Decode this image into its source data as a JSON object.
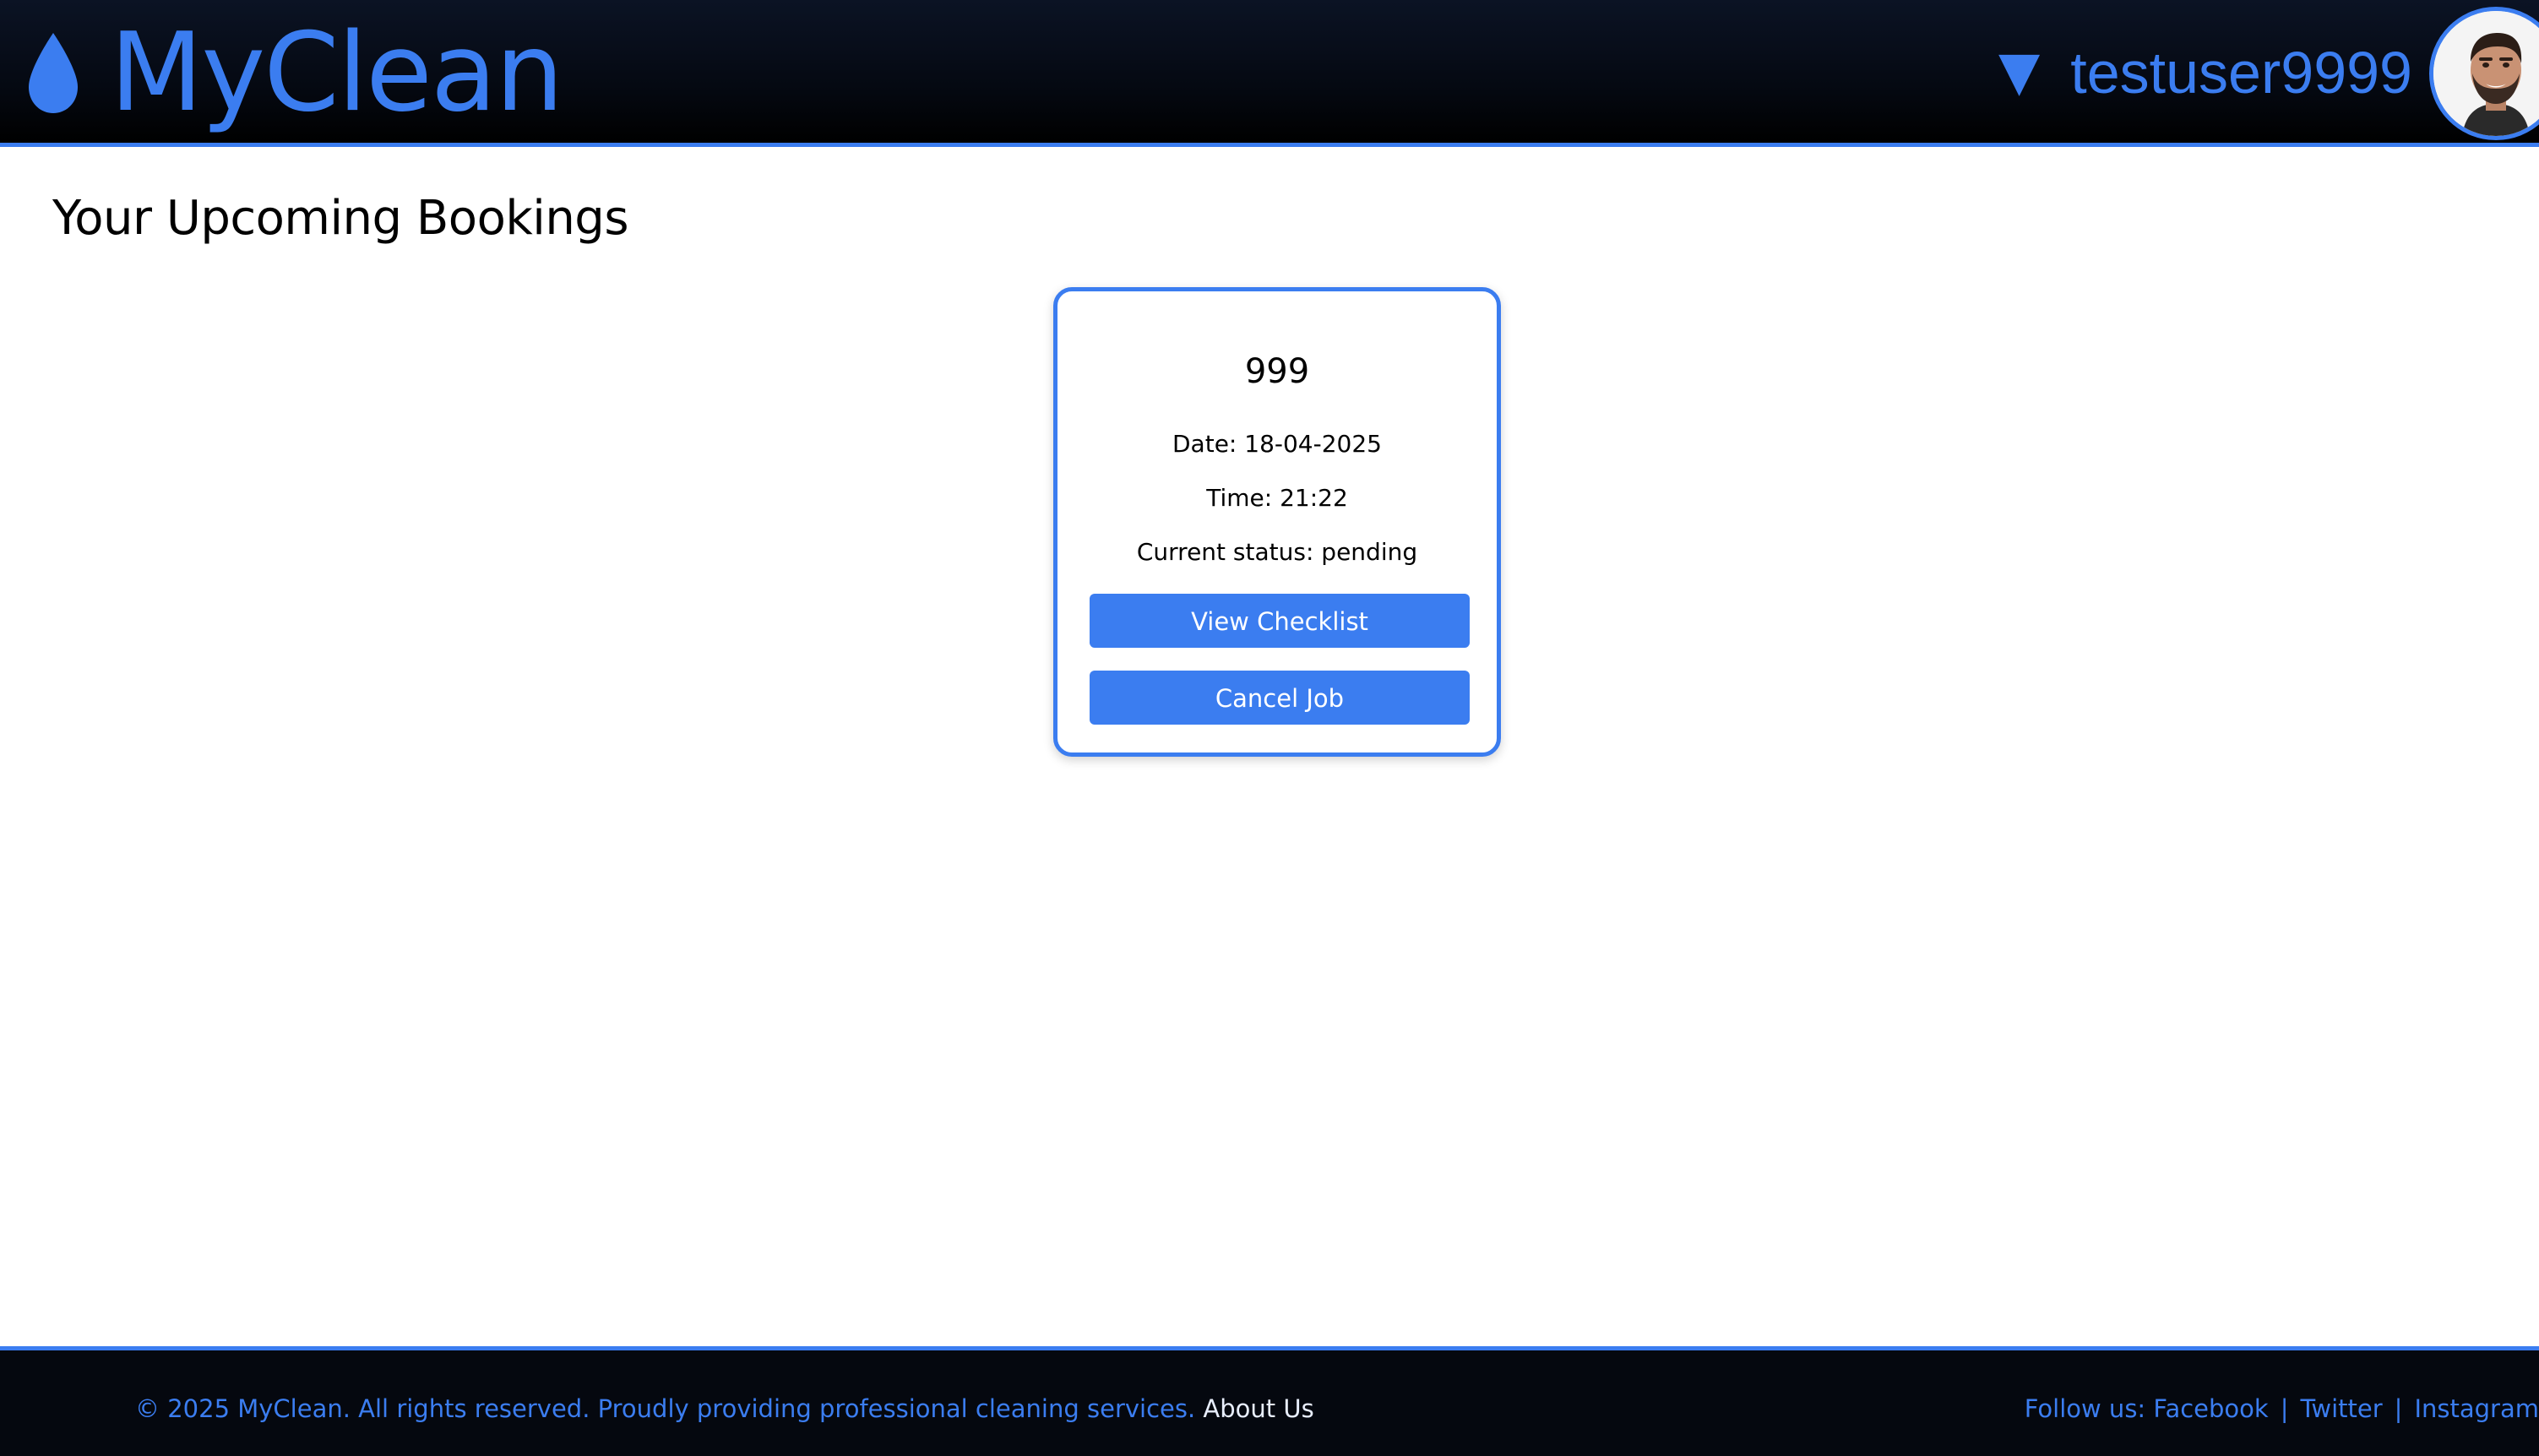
{
  "header": {
    "logo_text": "MyClean",
    "logo_icon": "water-drop-icon",
    "user_menu_icon": "caret-down-icon",
    "username": "testuser9999",
    "avatar_icon": "user-avatar"
  },
  "main": {
    "title": "Your Upcoming Bookings",
    "bookings": [
      {
        "id": "999",
        "date": "Date: 18-04-2025",
        "time": "Time: 21:22",
        "status": "Current status: pending",
        "view_checklist_label": "View Checklist",
        "cancel_label": "Cancel Job"
      }
    ]
  },
  "footer": {
    "copyright": "© 2025 MyClean. All rights reserved. Proudly providing professional cleaning services.",
    "about_label": "About Us",
    "follow_label": "Follow us:",
    "social": [
      "Facebook",
      "Twitter",
      "Instagram"
    ],
    "separator": "|"
  },
  "colors": {
    "accent": "#3b7df0",
    "header_bg": "#050912",
    "footer_bg": "#05080f"
  }
}
